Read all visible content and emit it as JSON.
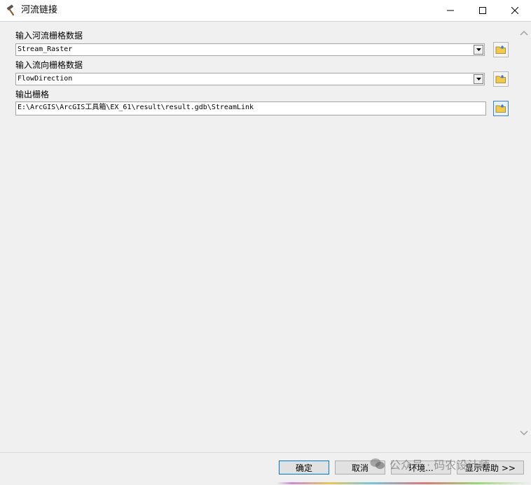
{
  "window": {
    "title": "河流链接",
    "app_icon": "hammer-icon"
  },
  "fields": [
    {
      "label": "输入河流栅格数据",
      "value": "Stream_Raster",
      "type": "dropdown"
    },
    {
      "label": "输入流向栅格数据",
      "value": "FlowDirection",
      "type": "dropdown"
    },
    {
      "label": "输出栅格",
      "value": "E:\\ArcGIS\\ArcGIS工具箱\\EX_61\\result\\result.gdb\\StreamLink",
      "type": "text"
    }
  ],
  "buttons": {
    "ok": "确定",
    "cancel": "取消",
    "environments": "环境...",
    "show_help": "显示帮助 >>"
  },
  "watermark": {
    "text": "公众号 · 码农设计师",
    "icon": "wechat-icon"
  },
  "colors": {
    "focus_border": "#3c7fd8",
    "folder_yellow": "#f2c94c"
  }
}
